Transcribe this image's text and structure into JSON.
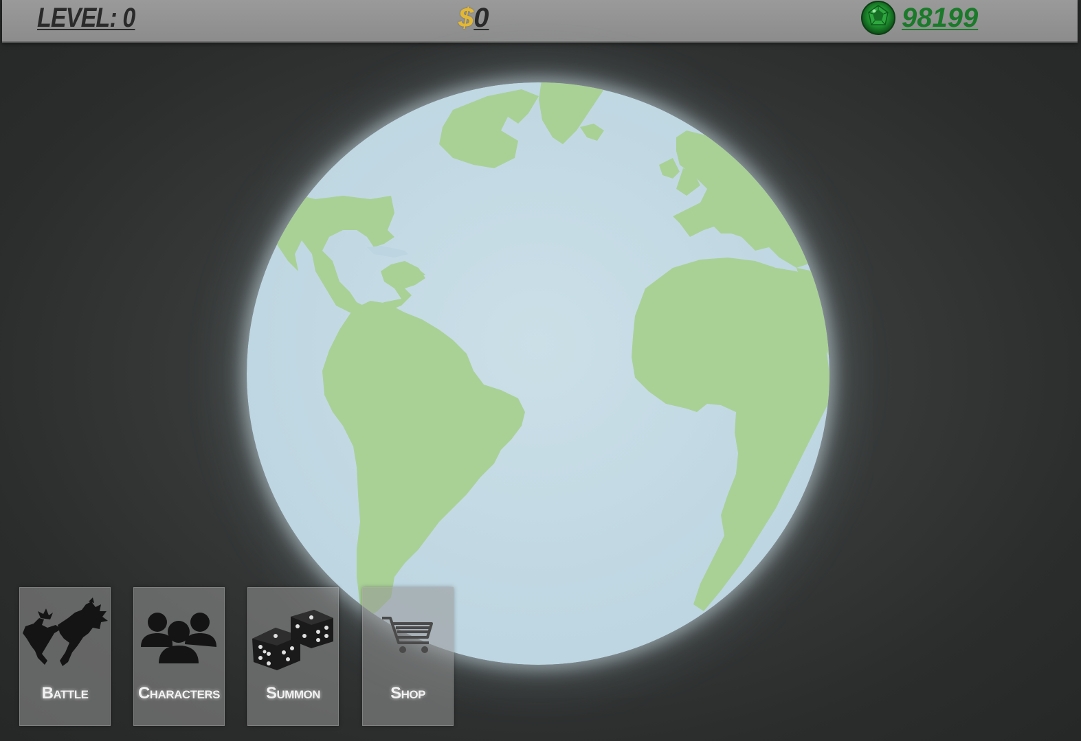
{
  "hud": {
    "level_text": "LEVEL: 0",
    "money_symbol": "$",
    "money_value": "0",
    "gems_value": "98199",
    "gem_icon": "emerald-gem-icon",
    "colors": {
      "bar": "#8f8f8f",
      "money_symbol": "#e4b832",
      "gems": "#1b7a2a"
    }
  },
  "world": {
    "icon": "earth-globe",
    "colors": {
      "ocean": "#c3d9e3",
      "land": "#a9d196"
    }
  },
  "menu": {
    "items": [
      {
        "label": "Battle",
        "icon": "fighters-silhouette-icon"
      },
      {
        "label": "Characters",
        "icon": "users-group-icon"
      },
      {
        "label": "Summon",
        "icon": "dice-icon"
      },
      {
        "label": "Shop",
        "icon": "shopping-cart-icon"
      }
    ]
  }
}
